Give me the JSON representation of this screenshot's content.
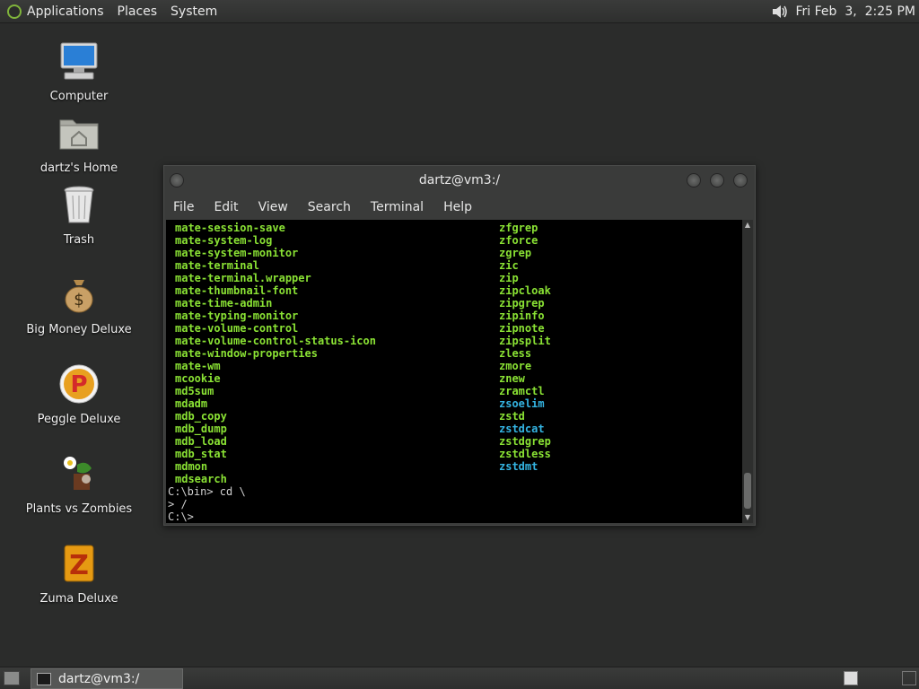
{
  "top_panel": {
    "menus": [
      "Applications",
      "Places",
      "System"
    ],
    "clock": "Fri Feb  3,  2:25 PM",
    "volume_icon": "speaker-icon"
  },
  "desktop": {
    "icons": [
      {
        "label": "Computer",
        "icon": "computer-icon"
      },
      {
        "label": "dartz's Home",
        "icon": "home-folder-icon"
      },
      {
        "label": "Trash",
        "icon": "trash-icon"
      },
      {
        "label": "Big Money Deluxe",
        "icon": "money-bag-icon"
      },
      {
        "label": "Peggle Deluxe",
        "icon": "peggle-icon"
      },
      {
        "label": "Plants vs Zombies",
        "icon": "plants-vs-zombies-icon"
      },
      {
        "label": "Zuma Deluxe",
        "icon": "zuma-icon"
      }
    ]
  },
  "terminal": {
    "title": "dartz@vm3:/",
    "menu": [
      "File",
      "Edit",
      "View",
      "Search",
      "Terminal",
      "Help"
    ],
    "left_column": [
      "mate-session-save",
      "mate-system-log",
      "mate-system-monitor",
      "mate-terminal",
      "mate-terminal.wrapper",
      "mate-thumbnail-font",
      "mate-time-admin",
      "mate-typing-monitor",
      "mate-volume-control",
      "mate-volume-control-status-icon",
      "mate-window-properties",
      "mate-wm",
      "mcookie",
      "md5sum",
      "mdadm",
      "mdb_copy",
      "mdb_dump",
      "mdb_load",
      "mdb_stat",
      "mdmon",
      "mdsearch"
    ],
    "right_column": [
      {
        "text": "zfgrep",
        "color": "#8ae234"
      },
      {
        "text": "zforce",
        "color": "#8ae234"
      },
      {
        "text": "zgrep",
        "color": "#8ae234"
      },
      {
        "text": "zic",
        "color": "#8ae234"
      },
      {
        "text": "zip",
        "color": "#8ae234"
      },
      {
        "text": "zipcloak",
        "color": "#8ae234"
      },
      {
        "text": "zipgrep",
        "color": "#8ae234"
      },
      {
        "text": "zipinfo",
        "color": "#8ae234"
      },
      {
        "text": "zipnote",
        "color": "#8ae234"
      },
      {
        "text": "zipsplit",
        "color": "#8ae234"
      },
      {
        "text": "zless",
        "color": "#8ae234"
      },
      {
        "text": "zmore",
        "color": "#8ae234"
      },
      {
        "text": "znew",
        "color": "#8ae234"
      },
      {
        "text": "zramctl",
        "color": "#8ae234"
      },
      {
        "text": "zsoelim",
        "color": "#34b4e2"
      },
      {
        "text": "zstd",
        "color": "#8ae234"
      },
      {
        "text": "zstdcat",
        "color": "#34b4e2"
      },
      {
        "text": "zstdgrep",
        "color": "#8ae234"
      },
      {
        "text": "zstdless",
        "color": "#8ae234"
      },
      {
        "text": "zstdmt",
        "color": "#34b4e2"
      }
    ],
    "prompt_lines": [
      "C:\\bin> cd \\",
      "> /",
      "C:\\>"
    ]
  },
  "bottom_panel": {
    "task_label": "dartz@vm3:/"
  },
  "colors": {
    "desktop_bg": "#2b2c2b",
    "exec_green": "#8ae234",
    "link_cyan": "#34b4e2"
  }
}
